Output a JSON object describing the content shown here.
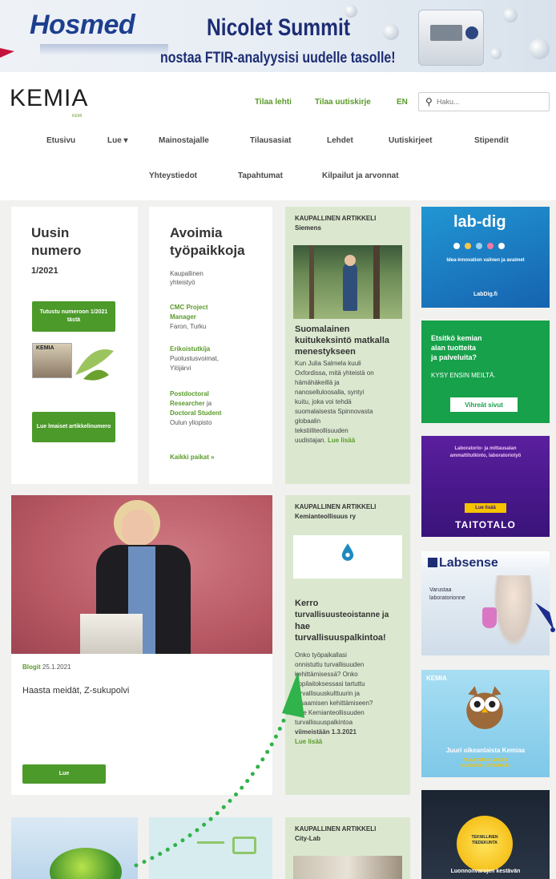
{
  "banner": {
    "brand": "Hosmed",
    "product": "Nicolet Summit",
    "tagline": "nostaa FTIR-analyysisi uudelle tasolle!"
  },
  "header": {
    "logo": "KEMIA",
    "logo_sub": "KEMI",
    "top_links": [
      "Tilaa lehti",
      "Tilaa uutiskirje",
      "EN"
    ],
    "search_placeholder": "Haku..."
  },
  "nav": {
    "row1": [
      "Etusivu",
      "Lue ▾",
      "Mainostajalle",
      "Tilausasiat",
      "Lehdet",
      "Uutiskirjeet",
      "Stipendit"
    ],
    "row2": [
      "Yhteystiedot",
      "Tapahtumat",
      "Kilpailut ja arvonnat"
    ]
  },
  "latest_issue": {
    "title_line1": "Uusin",
    "title_line2": "numero",
    "issue": "1/2021",
    "button": "Tutustu numeroon 1/2021 tästä",
    "cover": "KEMIA",
    "read_button": "Lue lmaiset artikkelinumero"
  },
  "jobs": {
    "title_line1": "Avoimia",
    "title_line2": "työpaikkoja",
    "sub": [
      "Kaupallinen",
      "yhteistyö"
    ],
    "items": [
      {
        "title": "CMC Project",
        "title2": "Manager",
        "org": "Faron, Turku"
      },
      {
        "title": "Erikoistutkija",
        "org": "Puolustusvoimat,",
        "org2": "Ylöjärvi"
      },
      {
        "title": "Postdoctoral",
        "title2": "Researcher",
        "mid": " ja ",
        "title3": "Doctoral Student",
        "org": "Oulun yliopisto"
      }
    ],
    "all_link": "Kaikki paikat »"
  },
  "sponsored1": {
    "kicker": "KAUPALLINEN ARTIKKELI",
    "sponsor": "Siemens",
    "title": [
      "Suomalainen",
      "kuituk​eksintö matkalla",
      "menestykseen"
    ],
    "body": [
      "Kun Julia Salmela kuuli",
      "Oxfordissa, mitä yhteistä on",
      "hämähäkeillä ja",
      "nanoselluloosalla, syntyi",
      "kuitu, joka voi tehdä",
      "suomalaisesta Spinnovasta",
      "globaalin",
      "tekstiiliteollisuuden",
      "uudistajan."
    ],
    "more": "Lue lisää"
  },
  "sponsored2": {
    "kicker": "KAUPALLINEN ARTIKKELI",
    "sponsor": "Kemianteollisuus ry",
    "title": [
      "Kerro",
      "turvallisuusteoistanne ja",
      "hae",
      "turvallisuuspalkintoa!"
    ],
    "body": [
      "Onko työpaikallasi",
      "onnistuttu turvallisuuden",
      "kehittämisessä? Onko",
      "oppilaitoksessasi tartuttu",
      "turvallisuuskulttuurin ja",
      "-osaamisen kehittämiseen?",
      "Hae Kemianteollisuuden",
      "turvallisuuspalkintoa",
      "viimeistään 1.3.2021"
    ],
    "more": "Lue lisää"
  },
  "sponsored3": {
    "kicker": "KAUPALLINEN ARTIKKELI",
    "sponsor": "City-Lab"
  },
  "blog": {
    "category": "Blogit",
    "date": "25.1.2021",
    "title": "Haasta meidät, Z-sukupolvi",
    "button": "Lue"
  },
  "ads": {
    "labdig": {
      "name": "lab-dig",
      "text1": "Idea-innovation valinen ja avaimet",
      "text2": "LabDig.fi"
    },
    "vihreat": {
      "q1": "Etsitkö kemian",
      "q2": "alan tuotteita",
      "q3": "ja palveluita?",
      "cta": "KYSY ENSIN MEILTÄ.",
      "button": "Vihreät sivut"
    },
    "taitotalo": {
      "line1": "Laboratorio- ja mittausalan",
      "line2": "ammattitutkinto, laboratoriotyö",
      "button": "Lue lisää",
      "brand": "TAITOTALO"
    },
    "labsense": {
      "brand": "Labsense",
      "text": "Varustaa",
      "text2": "laboratorionne"
    },
    "kemia_ad": {
      "logo": "KEMIA",
      "headline": "Juuri oikeanlaista Kemiaa",
      "sub": "TILAA KEMIA-LEHDEN",
      "sub2": "MAKSUTON UUTISKIRJE!"
    },
    "tekniikka": {
      "line1": "TEKNILLINEN",
      "line2": "TIEDEKUNTA",
      "line3": "Luonnonvarojen kestävän"
    }
  }
}
